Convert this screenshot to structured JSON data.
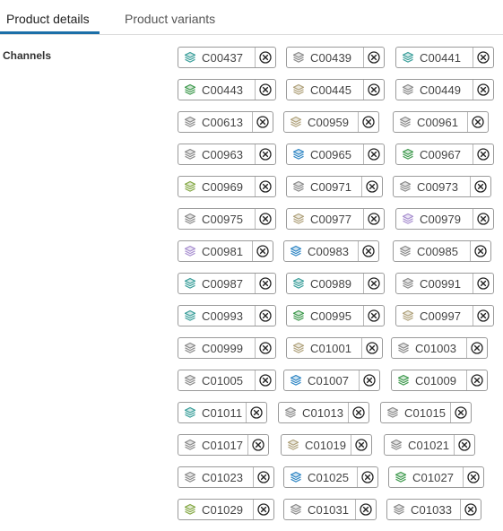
{
  "tabs": [
    {
      "label": "Product details",
      "active": true
    },
    {
      "label": "Product variants",
      "active": false
    }
  ],
  "channels_label": "Channels",
  "colors": {
    "accent": "#1b6fa8",
    "icon_teal": "#3a9e9a",
    "icon_green": "#3f9a4e",
    "icon_gray": "#8a8a8a",
    "icon_tan": "#b0a27c",
    "icon_blue": "#2f86c4",
    "icon_lime": "#84a844",
    "icon_purple": "#a88fd0"
  },
  "chip_icon": "layers-icon",
  "remove_icon": "close-circle-icon",
  "channel_rows": [
    [
      {
        "code": "C00437",
        "color": "#3a9e9a"
      },
      {
        "code": "C00439",
        "color": "#8a8a8a"
      },
      {
        "code": "C00441",
        "color": "#3a9e9a"
      }
    ],
    [
      {
        "code": "C00443",
        "color": "#3f9a4e"
      },
      {
        "code": "C00445",
        "color": "#b0a27c"
      },
      {
        "code": "C00449",
        "color": "#8a8a8a"
      }
    ],
    [
      {
        "code": "C00613",
        "color": "#8a8a8a"
      },
      {
        "code": "C00959",
        "color": "#b0a27c"
      },
      {
        "code": "C00961",
        "color": "#8a8a8a"
      }
    ],
    [
      {
        "code": "C00963",
        "color": "#8a8a8a"
      },
      {
        "code": "C00965",
        "color": "#2f86c4"
      },
      {
        "code": "C00967",
        "color": "#3f9a4e"
      }
    ],
    [
      {
        "code": "C00969",
        "color": "#84a844"
      },
      {
        "code": "C00971",
        "color": "#8a8a8a"
      },
      {
        "code": "C00973",
        "color": "#8a8a8a"
      }
    ],
    [
      {
        "code": "C00975",
        "color": "#8a8a8a"
      },
      {
        "code": "C00977",
        "color": "#b0a27c"
      },
      {
        "code": "C00979",
        "color": "#a88fd0"
      }
    ],
    [
      {
        "code": "C00981",
        "color": "#a88fd0"
      },
      {
        "code": "C00983",
        "color": "#2f86c4"
      },
      {
        "code": "C00985",
        "color": "#8a8a8a"
      }
    ],
    [
      {
        "code": "C00987",
        "color": "#3a9e9a"
      },
      {
        "code": "C00989",
        "color": "#3a9e9a"
      },
      {
        "code": "C00991",
        "color": "#8a8a8a"
      }
    ],
    [
      {
        "code": "C00993",
        "color": "#3a9e9a"
      },
      {
        "code": "C00995",
        "color": "#3f9a4e"
      },
      {
        "code": "C00997",
        "color": "#b0a27c"
      }
    ],
    [
      {
        "code": "C00999",
        "color": "#8a8a8a"
      },
      {
        "code": "C01001",
        "color": "#b0a27c"
      },
      {
        "code": "C01003",
        "color": "#8a8a8a"
      }
    ],
    [
      {
        "code": "C01005",
        "color": "#8a8a8a"
      },
      {
        "code": "C01007",
        "color": "#2f86c4"
      },
      {
        "code": "C01009",
        "color": "#3f9a4e"
      }
    ],
    [
      {
        "code": "C01011",
        "color": "#3a9e9a"
      },
      {
        "code": "C01013",
        "color": "#8a8a8a"
      },
      {
        "code": "C01015",
        "color": "#8a8a8a"
      }
    ],
    [
      {
        "code": "C01017",
        "color": "#8a8a8a"
      },
      {
        "code": "C01019",
        "color": "#b0a27c"
      },
      {
        "code": "C01021",
        "color": "#8a8a8a"
      }
    ],
    [
      {
        "code": "C01023",
        "color": "#8a8a8a"
      },
      {
        "code": "C01025",
        "color": "#2f86c4"
      },
      {
        "code": "C01027",
        "color": "#3f9a4e"
      }
    ],
    [
      {
        "code": "C01029",
        "color": "#84a844"
      },
      {
        "code": "C01031",
        "color": "#8a8a8a"
      },
      {
        "code": "C01033",
        "color": "#8a8a8a"
      }
    ]
  ]
}
